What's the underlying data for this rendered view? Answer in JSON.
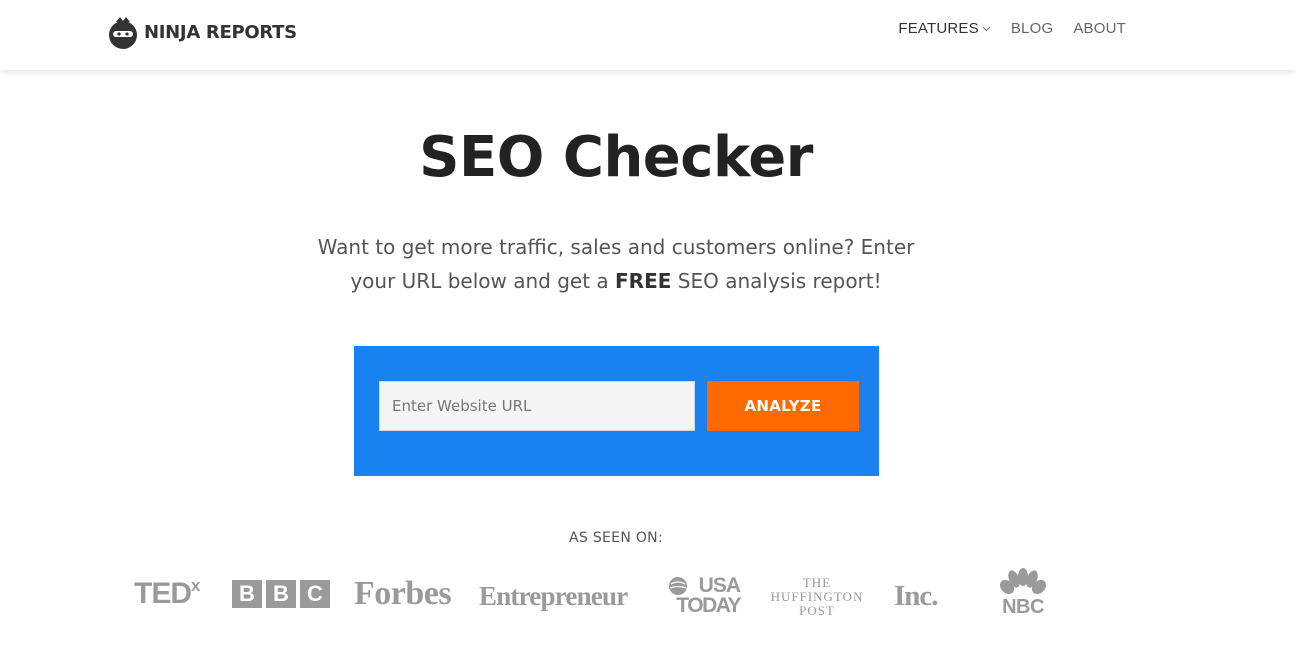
{
  "header": {
    "logo_text": "NINJA REPORTS",
    "nav": [
      {
        "label": "FEATURES"
      },
      {
        "label": "BLOG"
      },
      {
        "label": "ABOUT"
      }
    ]
  },
  "hero": {
    "title": "SEO Checker",
    "subtitle_part1": "Want to get more traffic, sales and customers online? Enter your URL below and get a ",
    "subtitle_bold": "FREE",
    "subtitle_part2": " SEO analysis report!"
  },
  "form": {
    "url_placeholder": "Enter Website URL",
    "url_value": "",
    "analyze_label": "ANALYZE"
  },
  "seen_on": {
    "label": "AS SEEN ON:",
    "logos": [
      {
        "name": "TEDx",
        "text": "TED",
        "sup": "x"
      },
      {
        "name": "BBC",
        "letters": [
          "B",
          "B",
          "C"
        ]
      },
      {
        "name": "Forbes",
        "text": "Forbes"
      },
      {
        "name": "Entrepreneur",
        "text": "Entrepreneur"
      },
      {
        "name": "USA TODAY",
        "line1": "USA",
        "line2": "TODAY"
      },
      {
        "name": "The Huffington Post",
        "line1": "THE",
        "line2": "HUFFINGTON",
        "line3": "POST"
      },
      {
        "name": "Inc.",
        "text": "Inc."
      },
      {
        "name": "NBC",
        "text": "NBC"
      }
    ]
  },
  "colors": {
    "form_bg": "#1a82f0",
    "button_bg": "#ff6a00",
    "logo_gray": "#9a9a9a"
  }
}
